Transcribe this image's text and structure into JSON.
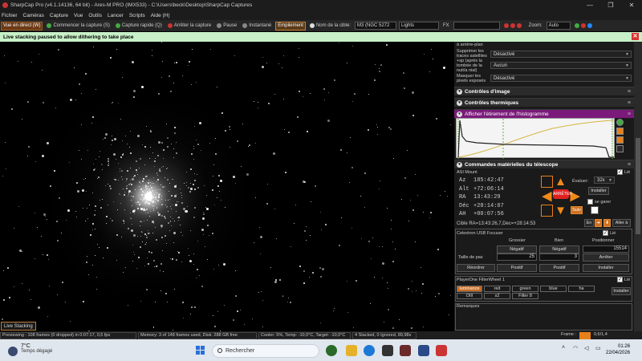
{
  "window": {
    "title": "SharpCap Pro (v4.1.14136, 64 bit) - Ares-M PRO (IMX533) - C:\\Users\\beck\\Desktop\\SharpCap Captures",
    "minimize": "—",
    "maximize": "❐",
    "close": "✕"
  },
  "menu": [
    "Fichier",
    "Caméras",
    "Capture",
    "Vue",
    "Outils",
    "Lancer",
    "Scripts",
    "Aide (H)"
  ],
  "toolbar": {
    "live_view": "Vue en direct (W)",
    "start_capture": "Commencer la capture (S)",
    "quick_capture": "Capture rapide (Q)",
    "stop_capture": "Arrêter la capture",
    "pause": "Pause",
    "snapshot": "Instantané",
    "stacking": "Empilement",
    "target_label": "Nom de la cible:",
    "target_value": "M3 (NGC 5272",
    "frame_type": "Lights",
    "fx_label": "FX",
    "zoom_label": "Zoom:",
    "zoom_value": "Auto"
  },
  "notification": {
    "text": "Live stacking paused to allow dithering to take place",
    "close": "✕"
  },
  "image": {
    "tab_label": "Live Stacking"
  },
  "panel": {
    "top_rows": [
      {
        "label": "à arrière-plan",
        "value": ""
      },
      {
        "label": "Supprimer les traces satellites +sp (après la tombée de la nuit/a nial)",
        "value": "Désactivé"
      },
      {
        "label": "",
        "value": "Aucun"
      },
      {
        "label": "Masquer les pixels exposés",
        "value": "Désactivé"
      }
    ],
    "image_controls": "Contrôles d'image",
    "thermal_controls": "Contrôles thermiques",
    "histogram": "Afficher l'étirement de l'histogramme",
    "telescope": "Commandes matérielles du télescope",
    "mount": {
      "name": "ASI Mount",
      "linked": "Lié",
      "az_label": "Az",
      "az": "185:42:47",
      "alt_label": "Alt",
      "alt": "+72:06:14",
      "ra_label": "RA",
      "ra": "13:43:29",
      "dec_label": "Déc",
      "dec": "+28:14:07",
      "ah_label": "AH",
      "ah": "+00:07:56",
      "rate_label": "Évaluer:",
      "rate": "32x",
      "install": "Installer",
      "park": "se garer",
      "stop": "ARRÊTER",
      "follow": "Suiv",
      "target_line": "Cible  RA=13:43:26,7,Dec=+28:14:53",
      "go_to": "Aller à"
    },
    "focuser": {
      "name": "Celestron USB Focuser",
      "linked": "Lié",
      "col_coarse": "Grossier",
      "col_fine": "Bien",
      "col_position": "Positionner",
      "negative": "Négatif",
      "negative2": "Négatif",
      "position_value": "15514",
      "step_label": "Taille de pas",
      "step_coarse": "25",
      "step_fine": "3",
      "stop": "Arrêter",
      "positive": "Positif",
      "positive2": "Positif",
      "reorder": "Réordrer",
      "install": "Installer"
    },
    "filterwheel": {
      "name": "PlayerOne FilterWheel 1",
      "linked": "Lié",
      "filters": [
        "luminance",
        "red",
        "green",
        "blue",
        "ha",
        "OIII",
        "s2",
        "Filter 8"
      ],
      "install": "Installer"
    },
    "notes_label": "Remarques"
  },
  "status": {
    "preview": "Previewing : 108 frames (0 dropped) in 0:07:17, 0,5 fps",
    "memory": "Memory: 3 of 148 frames used, Disk: 288 GB free",
    "cooler": "Cooler: 5%, Temp: -10,0°C, Target: -10,0°C",
    "stacked": "4 Stacked, 0 Ignored, 89,98s",
    "frame_label": "Frame :",
    "frame_value": "0,6/1,4"
  },
  "taskbar": {
    "temp": "7°C",
    "weather": "Temps dégagé",
    "search": "Rechercher",
    "time": "01:26",
    "date": "22/04/2026"
  }
}
